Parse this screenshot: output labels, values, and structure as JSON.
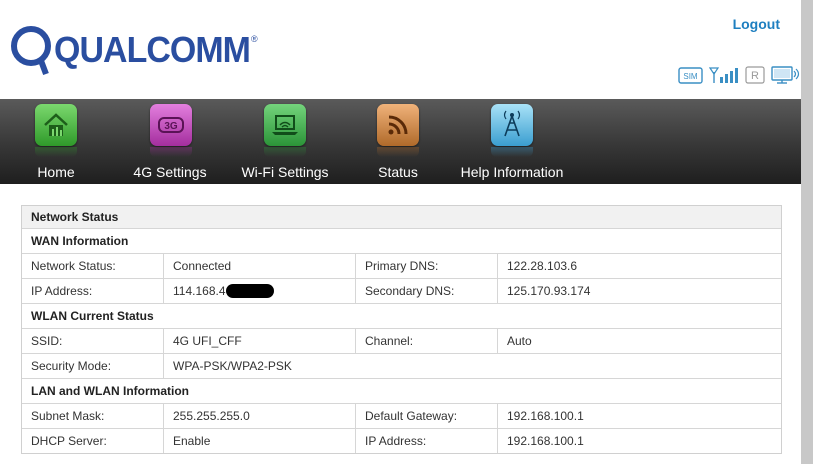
{
  "header": {
    "logo_text": "QUALCOMM",
    "logout_label": "Logout",
    "status_icons": [
      "sim-icon",
      "signal-icon",
      "roaming-icon",
      "connection-monitor-icon"
    ],
    "sim_label": "SIM",
    "roaming_label": "R"
  },
  "nav": {
    "items": [
      {
        "label": "Home",
        "icon": "home-icon",
        "color": "#3fb43a"
      },
      {
        "label": "4G Settings",
        "icon": "4g-icon",
        "color": "#c043b8",
        "icon_text": "3G"
      },
      {
        "label": "Wi-Fi Settings",
        "icon": "laptop-wifi-icon",
        "color": "#3aa84a"
      },
      {
        "label": "Status",
        "icon": "rss-icon",
        "color": "#c8783a"
      },
      {
        "label": "Help Information",
        "icon": "antenna-icon",
        "color": "#58b8e0"
      }
    ]
  },
  "network_status": {
    "title": "Network Status",
    "wan": {
      "title": "WAN Information",
      "rows": [
        {
          "l1": "Network Status:",
          "v1": "Connected",
          "l2": "Primary DNS:",
          "v2": "122.28.103.6"
        },
        {
          "l1": "IP Address:",
          "v1": "114.168.4",
          "l2": "Secondary DNS:",
          "v2": "125.170.93.174"
        }
      ]
    },
    "wlan": {
      "title": "WLAN Current Status",
      "rows": [
        {
          "l1": "SSID:",
          "v1": "4G UFI_CFF",
          "l2": "Channel:",
          "v2": "Auto"
        },
        {
          "l1": "Security Mode:",
          "v1": "WPA-PSK/WPA2-PSK"
        }
      ]
    },
    "lan": {
      "title": "LAN and WLAN Information",
      "rows": [
        {
          "l1": "Subnet Mask:",
          "v1": "255.255.255.0",
          "l2": "Default Gateway:",
          "v2": "192.168.100.1"
        },
        {
          "l1": "DHCP Server:",
          "v1": "Enable",
          "l2": "IP Address:",
          "v2": "192.168.100.1"
        }
      ]
    }
  }
}
